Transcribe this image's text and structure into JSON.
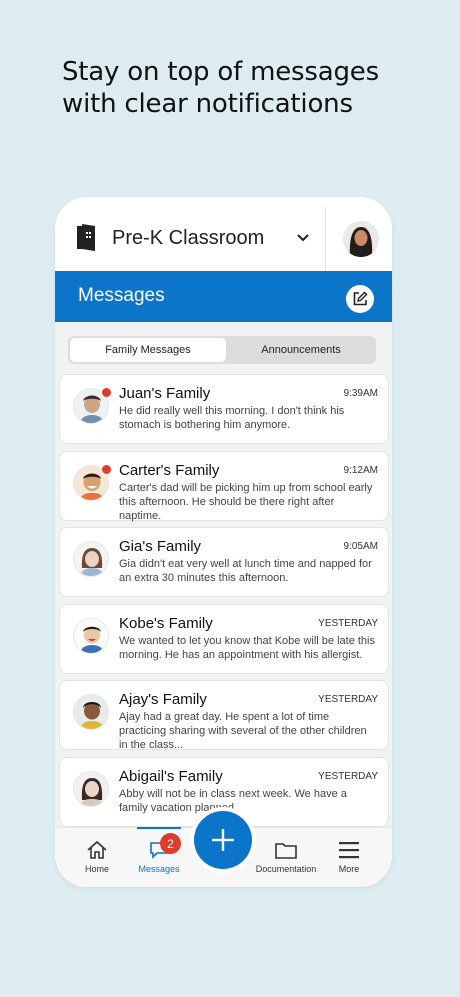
{
  "headline": {
    "line1": "Stay on top of messages",
    "line2": "with clear notifications"
  },
  "header": {
    "classroom": "Pre-K Classroom"
  },
  "page_title": "Messages",
  "tabs": [
    {
      "label": "Family Messages",
      "active": true
    },
    {
      "label": "Announcements",
      "active": false
    }
  ],
  "messages": [
    {
      "name": "Juan's Family",
      "time": "9:39AM",
      "preview": "He did really well this morning. I don't think his stomach is bothering him anymore.",
      "unread": true,
      "avatar_color": "#c9a58a"
    },
    {
      "name": "Carter's Family",
      "time": "9:12AM",
      "preview": "Carter's dad will be picking him up from school early this afternoon. He should be there right after naptime.",
      "unread": true,
      "avatar_color": "#d8a06a"
    },
    {
      "name": "Gia's Family",
      "time": "9:05AM",
      "preview": "Gia didn't eat very well at lunch time and napped for an extra 30 minutes this afternoon.",
      "unread": false,
      "avatar_color": "#e9d2c2"
    },
    {
      "name": "Kobe's Family",
      "time": "YESTERDAY",
      "preview": "We wanted to let you know that Kobe will be late this morning. He has an appointment with his allergist.",
      "unread": false,
      "avatar_color": "#e8c7a8"
    },
    {
      "name": "Ajay's Family",
      "time": "YESTERDAY",
      "preview": "Ajay had a great day. He spent a lot of time practicing sharing with several of the other children in the class...",
      "unread": false,
      "avatar_color": "#8a5a3c"
    },
    {
      "name": "Abigail's Family",
      "time": "YESTERDAY",
      "preview": "Abby will not be in class next week. We have a family vacation planned.",
      "unread": false,
      "avatar_color": "#ecd5c4"
    }
  ],
  "nav": {
    "home": "Home",
    "messages": "Messages",
    "documentation": "Documentation",
    "more": "More",
    "badge": "2"
  },
  "colors": {
    "brand_blue": "#0a75c9",
    "unread_red": "#e23a2c",
    "background": "#dcecf1"
  }
}
